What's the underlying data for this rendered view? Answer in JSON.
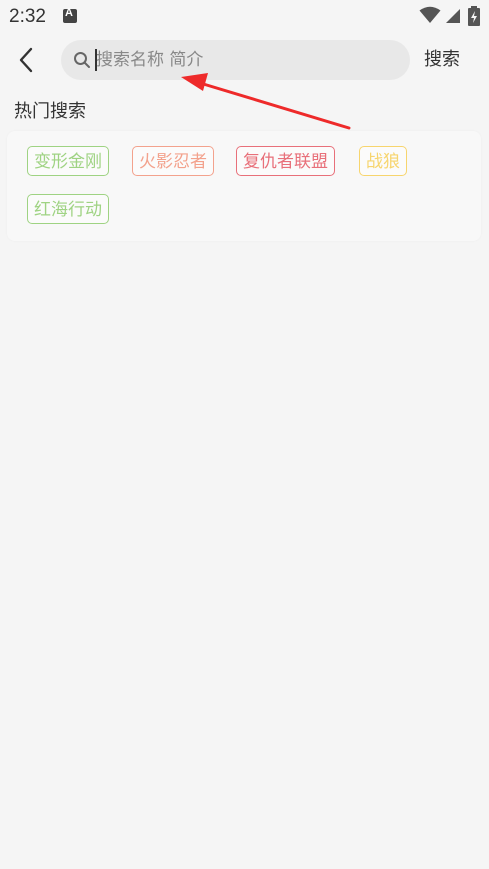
{
  "status_bar": {
    "time": "2:32"
  },
  "header": {
    "search_placeholder": "搜索名称 简介",
    "search_button": "搜索"
  },
  "hot_search": {
    "title": "热门搜索",
    "tags": [
      {
        "label": "变形金刚",
        "color": "#9fd383"
      },
      {
        "label": "火影忍者",
        "color": "#f3a28d"
      },
      {
        "label": "复仇者联盟",
        "color": "#e8707a"
      },
      {
        "label": "战狼",
        "color": "#f7d56e"
      },
      {
        "label": "红海行动",
        "color": "#9fd383"
      }
    ]
  },
  "annotation": {
    "arrow_color": "#ee2a2a"
  }
}
